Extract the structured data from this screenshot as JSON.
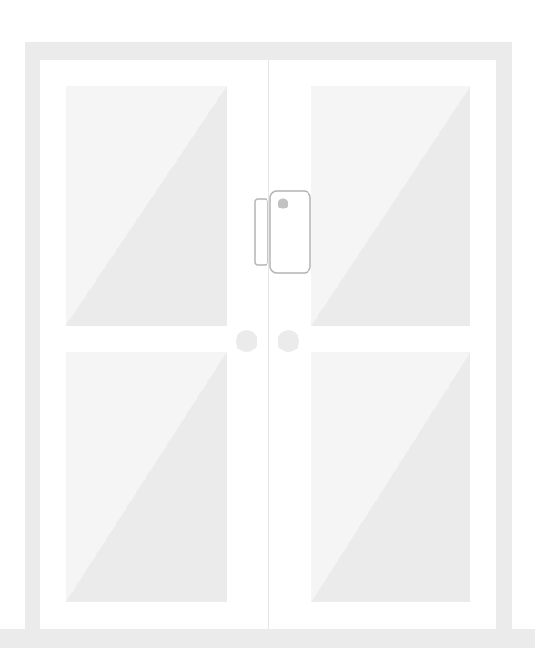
{
  "illustration": {
    "subject": "double-door-with-contact-sensor",
    "colors": {
      "background": "#ffffff",
      "frame": "#ebebeb",
      "floor": "#ebebeb",
      "door_leaf": "#ffffff",
      "door_seam": "#e6e6e6",
      "glass_light": "#f5f5f5",
      "glass_shade": "#ebebeb",
      "handle": "#ebebeb",
      "sensor_outline": "#b3b3b3",
      "sensor_body": "#ffffff",
      "sensor_led": "#c2c2c2"
    }
  }
}
